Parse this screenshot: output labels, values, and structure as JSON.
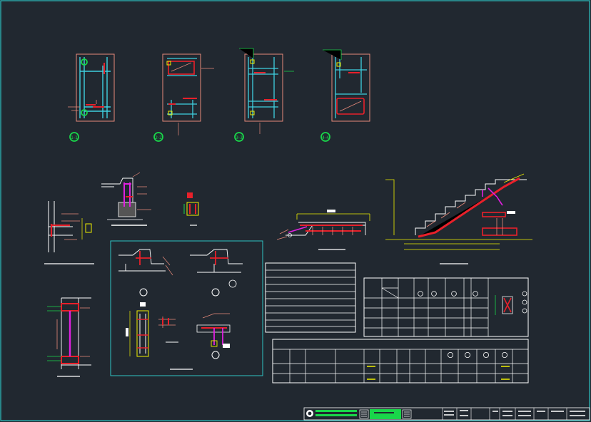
{
  "drawing": {
    "background": "#212830",
    "frame_color": "#2ec4c4",
    "colors": {
      "cyan": "#3fd0e0",
      "red": "#e8202a",
      "white": "#ffffff",
      "yellow": "#f0f000",
      "green": "#19d64a",
      "magenta": "#e020e0",
      "salmon": "#e88a7a",
      "teal": "#2ec4c4"
    }
  },
  "sections": [
    {
      "marker": "1-1"
    },
    {
      "marker": "2-2"
    },
    {
      "marker": "3-3"
    },
    {
      "marker": "4-4"
    }
  ],
  "title_block": {
    "logo_icon": "company-logo-icon"
  }
}
